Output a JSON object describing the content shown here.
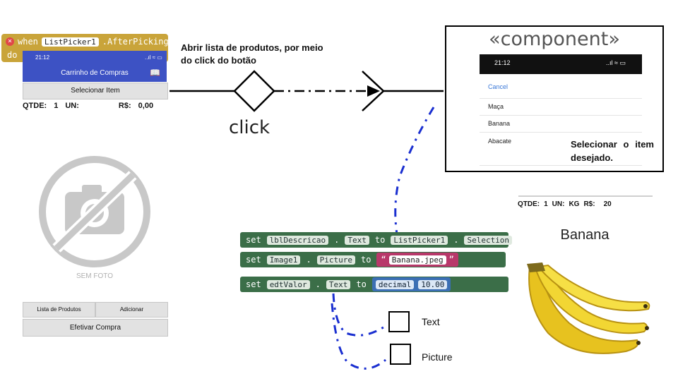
{
  "event_block": {
    "when": "when",
    "component": "ListPicker1",
    "event": ".AfterPicking",
    "do": "do"
  },
  "phone": {
    "time": "21:12",
    "status": "..ıl ≈ ▭",
    "title": "Carrinho de Compras",
    "book_icon": "book-icon",
    "select_button": "Selecionar Item",
    "qtde_label": "QTDE:",
    "qtde_value": "1",
    "un_label": "UN:",
    "rs_label": "R$:",
    "rs_value": "0,00",
    "no_photo_label": "SEM FOTO",
    "btn_lista": "Lista de Produtos",
    "btn_adicionar": "Adicionar",
    "btn_efetivar": "Efetivar Compra"
  },
  "connector": {
    "note": "Abrir lista de produtos, por meio do click do botão",
    "guard": "click"
  },
  "component": {
    "stereotype": "«component»",
    "time": "21:12",
    "status": "..ıl ≈ ▭",
    "cancel": "Cancel",
    "items": [
      "Maça",
      "Banana",
      "Abacate"
    ],
    "note": "Selecionar o item desejado."
  },
  "blocks": [
    {
      "set": "set",
      "target": "lblDescricao",
      "prop": "Text",
      "to": "to",
      "src": "ListPicker1",
      "src_prop": "Selection"
    },
    {
      "set": "set",
      "target": "Image1",
      "prop": "Picture",
      "to": "to",
      "value": "Banana.jpeg"
    },
    {
      "set": "set",
      "target": "edtValor",
      "prop": "Text",
      "to": "to",
      "type": "decimal",
      "value": "10.00"
    }
  ],
  "checkboxes": [
    "Text",
    "Picture"
  ],
  "result": {
    "qtde_label": "QTDE:",
    "qtde_value": "1",
    "un_label": "UN:",
    "un_value": "KG",
    "rs_label": "R$:",
    "rs_value": "20",
    "name": "Banana"
  },
  "colors": {
    "event_block": "#c9a43a",
    "phone_bar": "#3d52c4",
    "set_block": "#3b6e48",
    "text_block": "#b8386a",
    "math_block": "#3b6fb4",
    "dashed_link": "#1a2fd0"
  }
}
